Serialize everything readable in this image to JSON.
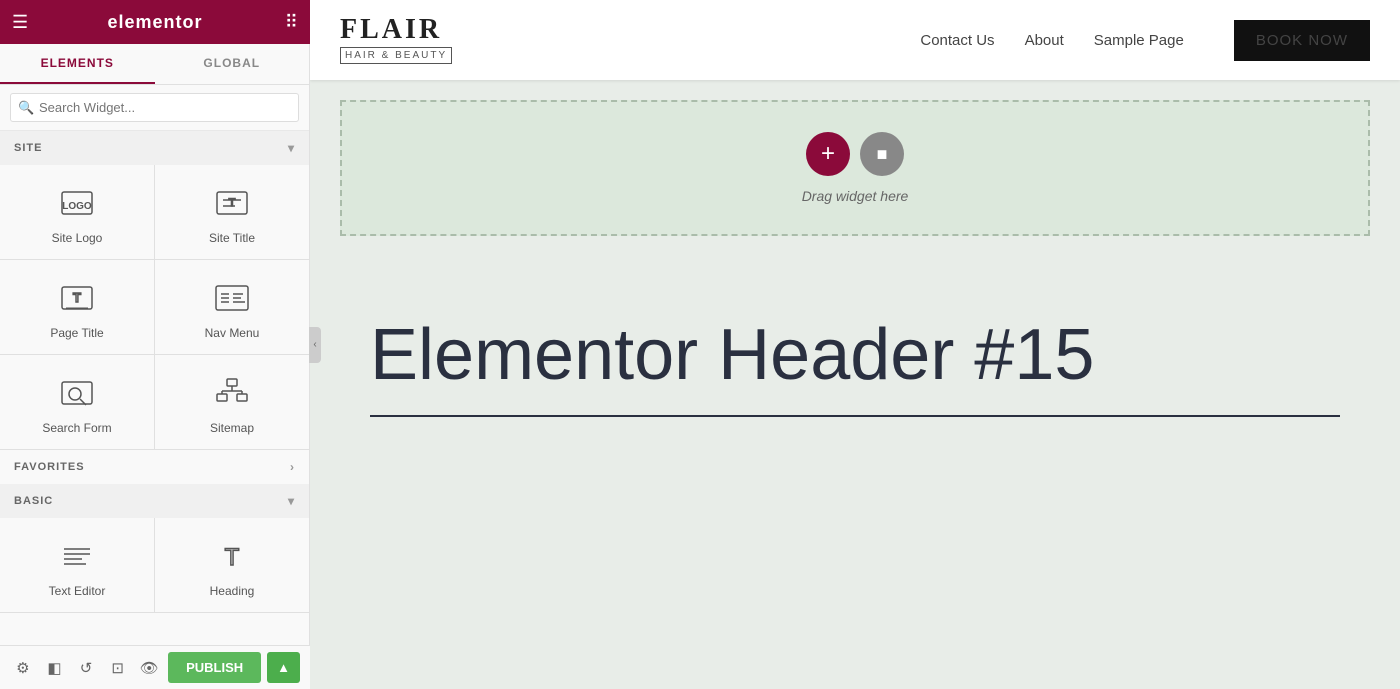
{
  "topbar": {
    "logo": "elementor",
    "hamburger_icon": "☰",
    "grid_icon": "⠿"
  },
  "sidebar": {
    "tabs": [
      {
        "id": "elements",
        "label": "ELEMENTS"
      },
      {
        "id": "global",
        "label": "GLOBAL"
      }
    ],
    "active_tab": "elements",
    "search_placeholder": "Search Widget...",
    "sections": [
      {
        "id": "site",
        "label": "SITE",
        "expanded": true,
        "widgets": [
          {
            "id": "site-logo",
            "label": "Site Logo"
          },
          {
            "id": "site-title",
            "label": "Site Title"
          },
          {
            "id": "page-title",
            "label": "Page Title"
          },
          {
            "id": "nav-menu",
            "label": "Nav Menu"
          },
          {
            "id": "search-form",
            "label": "Search Form"
          },
          {
            "id": "sitemap",
            "label": "Sitemap"
          }
        ]
      },
      {
        "id": "favorites",
        "label": "FAVORITES",
        "expanded": false
      },
      {
        "id": "basic",
        "label": "BASIC",
        "expanded": true,
        "widgets": [
          {
            "id": "text-align",
            "label": "Text Editor"
          },
          {
            "id": "heading",
            "label": "Heading"
          }
        ]
      }
    ]
  },
  "bottom_toolbar": {
    "icons": [
      "⚙",
      "◧",
      "↺",
      "⊡",
      "👁"
    ],
    "publish_label": "PUBLISH",
    "publish_arrow": "▲"
  },
  "canvas": {
    "navbar": {
      "logo_main": "FLAIR",
      "logo_sub": "HAIR & BEAUTY",
      "nav_links": [
        "Contact Us",
        "About",
        "Sample Page"
      ],
      "cta_label": "BOOK NOW"
    },
    "drop_zone": {
      "text": "Drag widget here"
    },
    "hero": {
      "title": "Elementor Header #15"
    }
  }
}
